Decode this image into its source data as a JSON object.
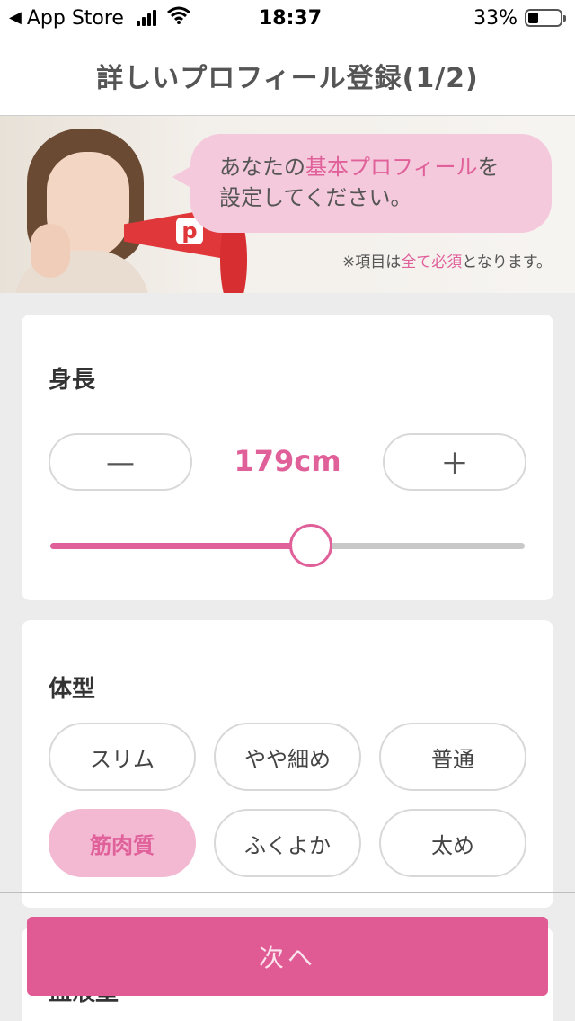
{
  "status_bar": {
    "back_label": "App Store",
    "time": "18:37",
    "battery": "33%",
    "battery_level": 0.33
  },
  "nav": {
    "title": "詳しいプロフィール登録(1/2)"
  },
  "banner": {
    "line1_prefix": "あなたの",
    "line1_highlight": "基本プロフィール",
    "line1_suffix": "を",
    "line2": "設定してください。",
    "note_prefix": "※項目は",
    "note_highlight": "全て必須",
    "note_suffix": "となります。",
    "megaphone_logo": "p"
  },
  "height_section": {
    "title": "身長",
    "minus_label": "—",
    "plus_label": "＋",
    "value": "179cm",
    "slider_fraction": 0.55
  },
  "body_section": {
    "title": "体型",
    "options": [
      "スリム",
      "やや細め",
      "普通",
      "筋肉質",
      "ふくよか",
      "太め"
    ],
    "selected": "筋肉質"
  },
  "next_section_peek": {
    "title": "血液型"
  },
  "footer": {
    "next_label": "次へ"
  },
  "colors": {
    "accent": "#e0609a",
    "button": "#e05b94",
    "selected_bg": "#f3b8d2",
    "bubble": "#f4c9db"
  }
}
